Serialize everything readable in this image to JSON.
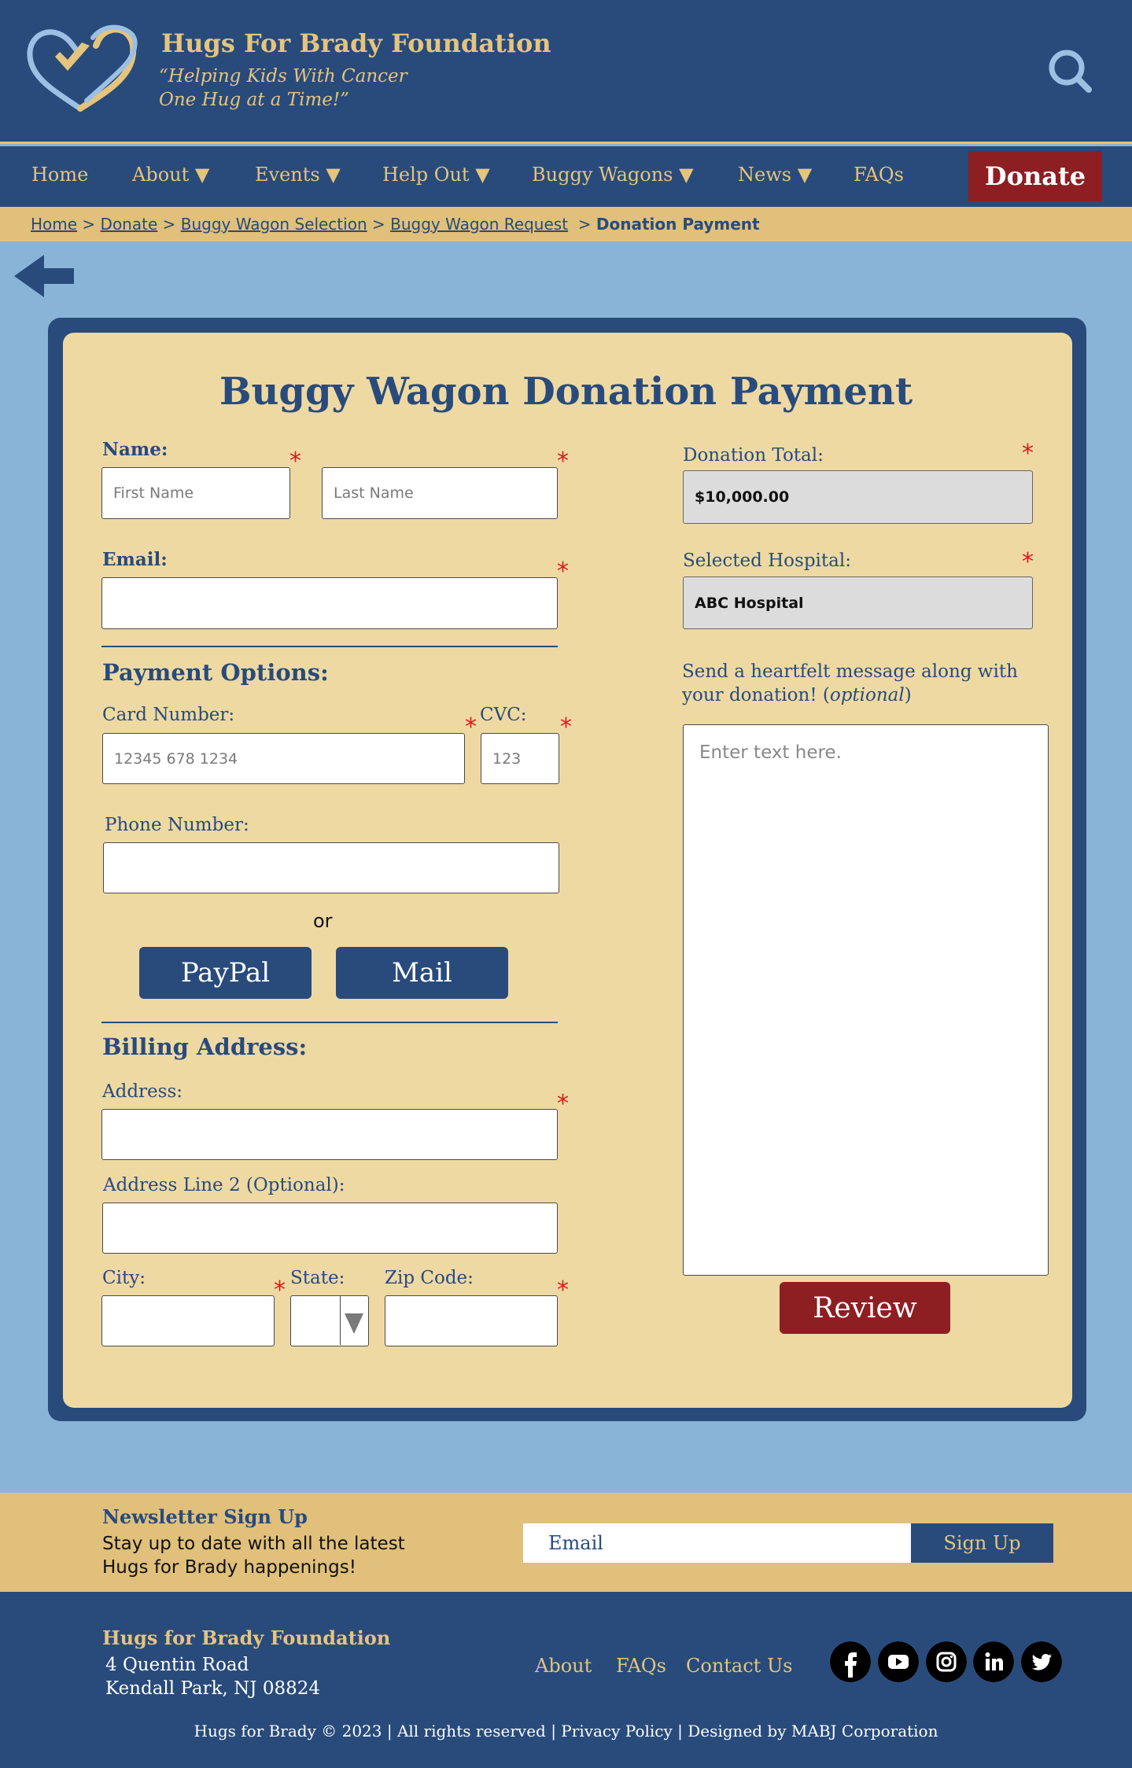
{
  "header": {
    "brand_title": "Hugs For Brady Foundation",
    "tagline": "“Helping Kids With Cancer\nOne Hug at a Time!”",
    "logo_icon": "heart-hug-logo",
    "search_icon": "search-icon"
  },
  "nav": {
    "items": [
      {
        "label": "Home"
      },
      {
        "label": "About ▼"
      },
      {
        "label": "Events ▼"
      },
      {
        "label": "Help Out ▼"
      },
      {
        "label": "Buggy Wagons ▼"
      },
      {
        "label": "News ▼"
      },
      {
        "label": "FAQs"
      }
    ],
    "donate_label": "Donate"
  },
  "breadcrumb": {
    "items": [
      "Home",
      "Donate",
      "Buggy Wagon Selection",
      "Buggy Wagon Request"
    ],
    "separator": ">",
    "current": "Donation Payment"
  },
  "form": {
    "title": "Buggy Wagon Donation Payment",
    "required_mark": "*",
    "name_label": "Name:",
    "first_name_placeholder": "First Name",
    "last_name_placeholder": "Last Name",
    "email_label": "Email:",
    "payment_heading": "Payment Options:",
    "card_label": "Card Number:",
    "card_placeholder": "12345 678 1234",
    "cvc_label": "CVC:",
    "cvc_placeholder": "123",
    "phone_label": "Phone Number:",
    "or_text": "or",
    "paypal_label": "PayPal",
    "mail_label": "Mail",
    "billing_heading": "Billing Address:",
    "address_label": "Address:",
    "address2_label": "Address Line 2 (Optional):",
    "city_label": "City:",
    "state_label": "State:",
    "zip_label": "Zip Code:",
    "donation_total_label": "Donation Total:",
    "donation_total_value": "$10,000.00",
    "hospital_label": "Selected Hospital:",
    "hospital_value": "ABC Hospital",
    "message_prompt_1": "Send a heartfelt message along with",
    "message_prompt_2": "your donation! (",
    "message_prompt_optional": "optional",
    "message_prompt_3": ")",
    "message_placeholder": "Enter text here.",
    "review_label": "Review"
  },
  "newsletter": {
    "title": "Newsletter Sign Up",
    "text": "Stay up to date with all the latest\nHugs for Brady happenings!",
    "email_placeholder": "Email",
    "button_label": "Sign Up"
  },
  "footer": {
    "org_name": "Hugs for Brady Foundation",
    "address_line1": "4 Quentin Road",
    "address_line2": "Kendall Park, NJ 08824",
    "links": [
      "About",
      "FAQs",
      "Contact Us"
    ],
    "social_icons": [
      "facebook-icon",
      "youtube-icon",
      "instagram-icon",
      "linkedin-icon",
      "twitter-icon"
    ],
    "copyright": "Hugs for Brady © 2023 | All rights reserved | Privacy Policy | Designed by MABJ Corporation"
  },
  "colors": {
    "navy": "#284b7c",
    "gold": "#e5c47c",
    "page_bg": "#89b4d8",
    "card_bg": "#eed9a3",
    "accent_red": "#8d1f23",
    "required_red": "#e01818"
  }
}
